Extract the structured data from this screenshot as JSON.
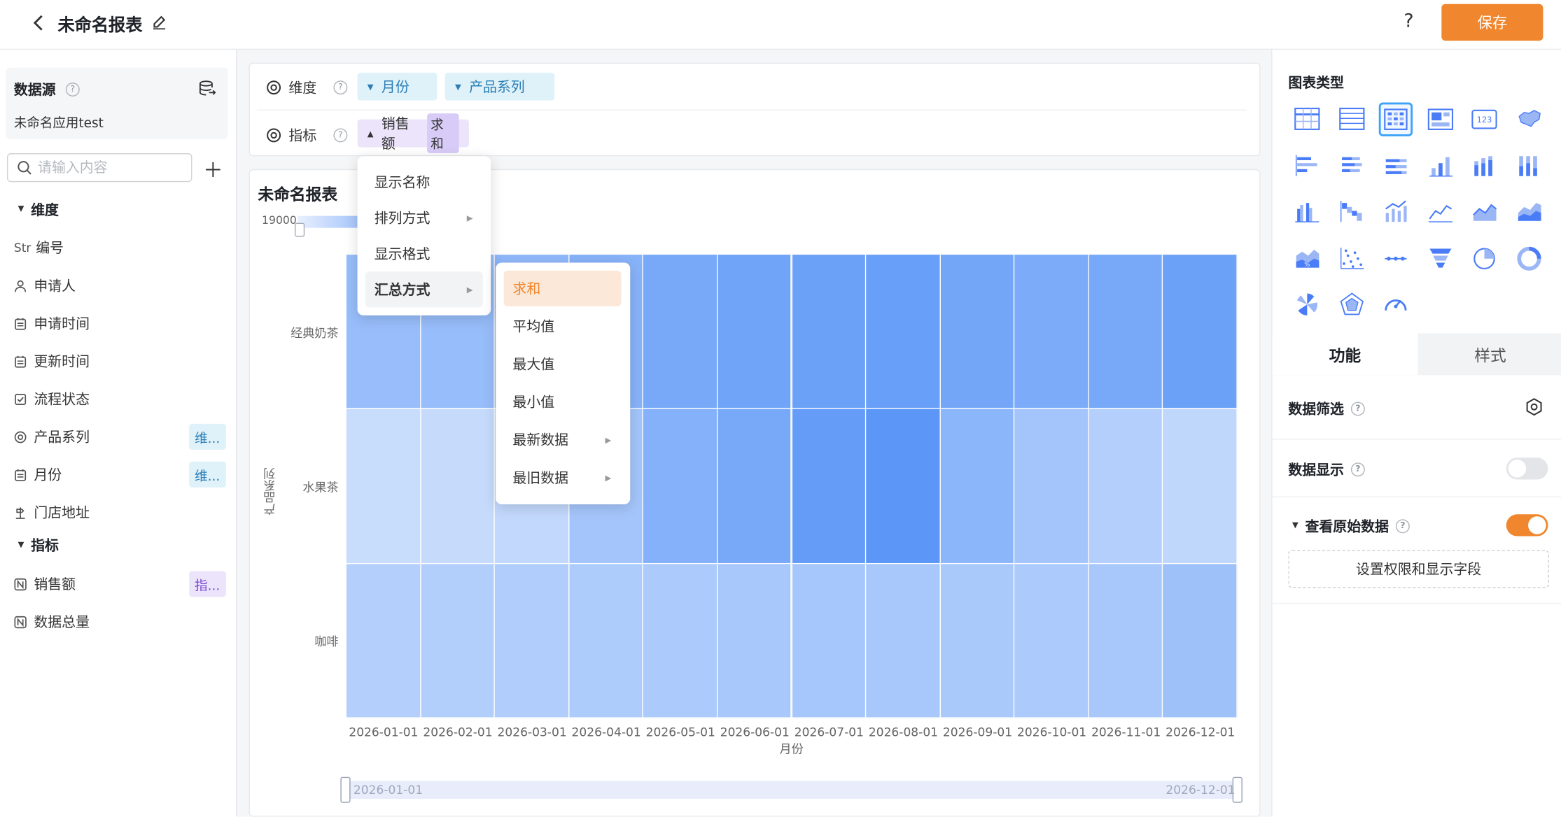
{
  "header": {
    "title": "未命名报表",
    "help": "?",
    "save_label": "保存"
  },
  "sidebar": {
    "datasource_label": "数据源",
    "datasource_name": "未命名应用test",
    "search_placeholder": "请输入内容",
    "dimensions_label": "维度",
    "dimension_fields": [
      {
        "icon": "Str",
        "label": "编号",
        "tag": ""
      },
      {
        "icon": "user-icon",
        "label": "申请人",
        "tag": ""
      },
      {
        "icon": "calendar-icon",
        "label": "申请时间",
        "tag": ""
      },
      {
        "icon": "calendar-icon",
        "label": "更新时间",
        "tag": ""
      },
      {
        "icon": "checkbox-icon",
        "label": "流程状态",
        "tag": ""
      },
      {
        "icon": "radio-icon",
        "label": "产品系列",
        "tag": "维..."
      },
      {
        "icon": "calendar-icon",
        "label": "月份",
        "tag": "维..."
      },
      {
        "icon": "location-icon",
        "label": "门店地址",
        "tag": ""
      }
    ],
    "metrics_label": "指标",
    "metric_fields": [
      {
        "icon": "number-icon",
        "label": "销售额",
        "tag": "指..."
      },
      {
        "icon": "number-icon",
        "label": "数据总量",
        "tag": ""
      }
    ]
  },
  "config": {
    "dimension_label": "维度",
    "dimension_chips": [
      "月份",
      "产品系列"
    ],
    "metric_label": "指标",
    "metric_chip": "销售额",
    "metric_agg": "求和"
  },
  "chart": {
    "title": "未命名报表",
    "legend_max": "19000",
    "slider_start": "2026-01-01",
    "slider_end": "2026-12-01"
  },
  "chart_data": {
    "type": "heatmap",
    "title": "未命名报表",
    "xlabel": "月份",
    "ylabel": "产品系列",
    "x": [
      "2026-01-01",
      "2026-02-01",
      "2026-03-01",
      "2026-04-01",
      "2026-05-01",
      "2026-06-01",
      "2026-07-01",
      "2026-08-01",
      "2026-09-01",
      "2026-10-01",
      "2026-11-01",
      "2026-12-01"
    ],
    "y": [
      "经典奶茶",
      "水果茶",
      "咖啡"
    ],
    "visual_max": 19000,
    "values": [
      [
        10500,
        10600,
        11500,
        12500,
        14500,
        15500,
        16000,
        16500,
        15000,
        14000,
        14500,
        16000
      ],
      [
        4500,
        4700,
        5200,
        9000,
        13000,
        14500,
        17000,
        18000,
        12000,
        9000,
        7000,
        5500
      ],
      [
        7000,
        7200,
        7500,
        7700,
        8000,
        8500,
        8700,
        8500,
        8300,
        8000,
        8500,
        9800
      ]
    ]
  },
  "field_menu": {
    "items": [
      {
        "label": "显示名称",
        "arrow": false
      },
      {
        "label": "排列方式",
        "arrow": true
      },
      {
        "label": "显示格式",
        "arrow": false
      },
      {
        "label": "汇总方式",
        "arrow": true
      }
    ]
  },
  "agg_menu": {
    "items": [
      {
        "label": "求和",
        "arrow": false
      },
      {
        "label": "平均值",
        "arrow": false
      },
      {
        "label": "最大值",
        "arrow": false
      },
      {
        "label": "最小值",
        "arrow": false
      },
      {
        "label": "最新数据",
        "arrow": true
      },
      {
        "label": "最旧数据",
        "arrow": true
      }
    ]
  },
  "right_panel": {
    "chart_type_label": "图表类型",
    "chart_types": [
      "table",
      "detail-table",
      "heatmap",
      "indicator-card",
      "number-card",
      "map",
      "bar-horizontal",
      "bar-stacked-horizontal",
      "bar-percent-horizontal",
      "column",
      "column-stacked",
      "column-percent",
      "column-group",
      "waterfall",
      "column-line",
      "line",
      "area",
      "area-stacked",
      "area-percent",
      "scatter",
      "dot-line",
      "funnel",
      "pie",
      "donut",
      "rose",
      "radar",
      "gauge"
    ],
    "tabs": [
      "功能",
      "样式"
    ],
    "data_filter_label": "数据筛选",
    "data_display_label": "数据显示",
    "raw_data_label": "查看原始数据",
    "permission_button": "设置权限和显示字段",
    "accent": "#f0862d"
  }
}
